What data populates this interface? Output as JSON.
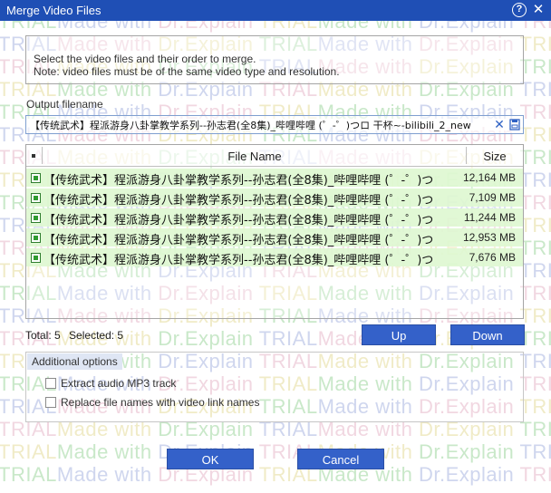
{
  "window": {
    "title": "Merge Video Files",
    "help_symbol": "?",
    "close_symbol": "✕"
  },
  "watermark": {
    "part_a": "Made with ",
    "part_b": "Dr.Explain ",
    "part_c": "TRIAL"
  },
  "instructions": {
    "line1": "Select the video files and their order to merge.",
    "line2": "Note: video files must be of the same video type and resolution."
  },
  "output": {
    "label": "Output filename",
    "value": "【传统武术】程派游身八卦掌教学系列--孙志君(全8集)_哔哩哔哩 (゜-゜)つロ 干杯~-bilibili_2_new",
    "clear_symbol": "✕"
  },
  "file_list": {
    "columns": {
      "name": "File Name",
      "size": "Size"
    },
    "rows": [
      {
        "name": "【传统武术】程派游身八卦掌教学系列--孙志君(全8集)_哔哩哔哩 (゜-゜)つロ 干杯~-bilibili",
        "size": "12,164 MB",
        "checked": true
      },
      {
        "name": "【传统武术】程派游身八卦掌教学系列--孙志君(全8集)_哔哩哔哩 (゜-゜)つロ 干杯~-bilibili",
        "size": "7,109 MB",
        "checked": true
      },
      {
        "name": "【传统武术】程派游身八卦掌教学系列--孙志君(全8集)_哔哩哔哩 (゜-゜)つロ 干杯~-bilibili",
        "size": "11,244 MB",
        "checked": true
      },
      {
        "name": "【传统武术】程派游身八卦掌教学系列--孙志君(全8集)_哔哩哔哩 (゜-゜)つロ 干杯~-bilibili",
        "size": "12,953 MB",
        "checked": true
      },
      {
        "name": "【传统武术】程派游身八卦掌教学系列--孙志君(全8集)_哔哩哔哩 (゜-゜)つロ 干杯~-bilibili",
        "size": "7,676 MB",
        "checked": true
      }
    ]
  },
  "status": {
    "total": "Total: 5",
    "selected": "Selected: 5"
  },
  "buttons": {
    "up": "Up",
    "down": "Down",
    "ok": "OK",
    "cancel": "Cancel"
  },
  "additional_options": {
    "title": "Additional options",
    "extract_audio": {
      "label": "Extract audio MP3 track",
      "checked": false
    },
    "replace_names": {
      "label": "Replace file names with video link names",
      "checked": false
    }
  },
  "colors": {
    "titlebar": "#1f4fb5",
    "button": "#3461c9",
    "row_highlight": "#def7d0",
    "check_green": "#2f9a2f"
  }
}
